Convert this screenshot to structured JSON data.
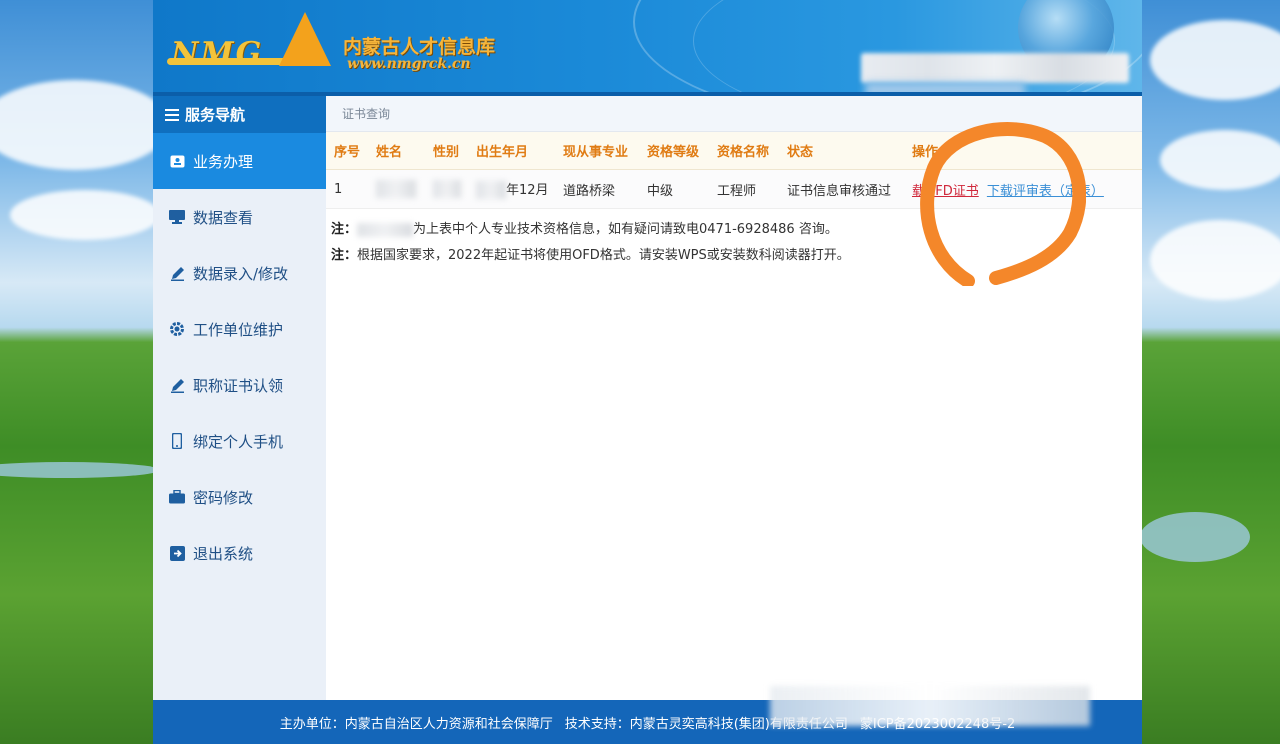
{
  "header": {
    "logo_mark": "NMG",
    "logo_cn": "内蒙古人才信息库",
    "logo_url": "www.nmgrck.cn"
  },
  "sidebar": {
    "title": "服务导航",
    "items": [
      {
        "label": "业务办理",
        "icon": "id-card-icon",
        "active": true
      },
      {
        "label": "数据查看",
        "icon": "monitor-icon"
      },
      {
        "label": "数据录入/修改",
        "icon": "pencil-icon"
      },
      {
        "label": "工作单位维护",
        "icon": "gear-icon"
      },
      {
        "label": "职称证书认领",
        "icon": "pencil-icon"
      },
      {
        "label": "绑定个人手机",
        "icon": "mobile-icon"
      },
      {
        "label": "密码修改",
        "icon": "briefcase-icon"
      },
      {
        "label": "退出系统",
        "icon": "logout-icon"
      }
    ]
  },
  "main": {
    "breadcrumb": "证书查询",
    "table": {
      "headers": [
        "序号",
        "姓名",
        "性别",
        "出生年月",
        "现从事专业",
        "资格等级",
        "资格名称",
        "状态",
        "操作"
      ],
      "rows": [
        {
          "index": "1",
          "birth_suffix": "年12月",
          "major": "道路桥梁",
          "level": "中级",
          "title": "工程师",
          "status": "证书信息审核通过",
          "action_ofd": "载OFD证书",
          "action_review": "下载评审表（定表）"
        }
      ]
    },
    "notes": {
      "prefix": "注：",
      "note1": "为上表中个人专业技术资格信息，如有疑问请致电0471-6928486 咨询。",
      "note2": "根据国家要求，2022年起证书将使用OFD格式。请安装WPS或安装数科阅读器打开。"
    }
  },
  "footer": {
    "host": "主办单位：内蒙古自治区人力资源和社会保障厅",
    "support": "技术支持：内蒙古灵奕高科技(集团)有限责任公司",
    "icp": "蒙ICP备2023002248号-2"
  },
  "colors": {
    "header_blue": "#1b8ad8",
    "sidebar_active": "#1a8ae0",
    "table_header_text": "#e07c14",
    "status_green": "#2e9a2e",
    "marker_orange": "#f4872a",
    "footer_blue": "#1466b9"
  }
}
